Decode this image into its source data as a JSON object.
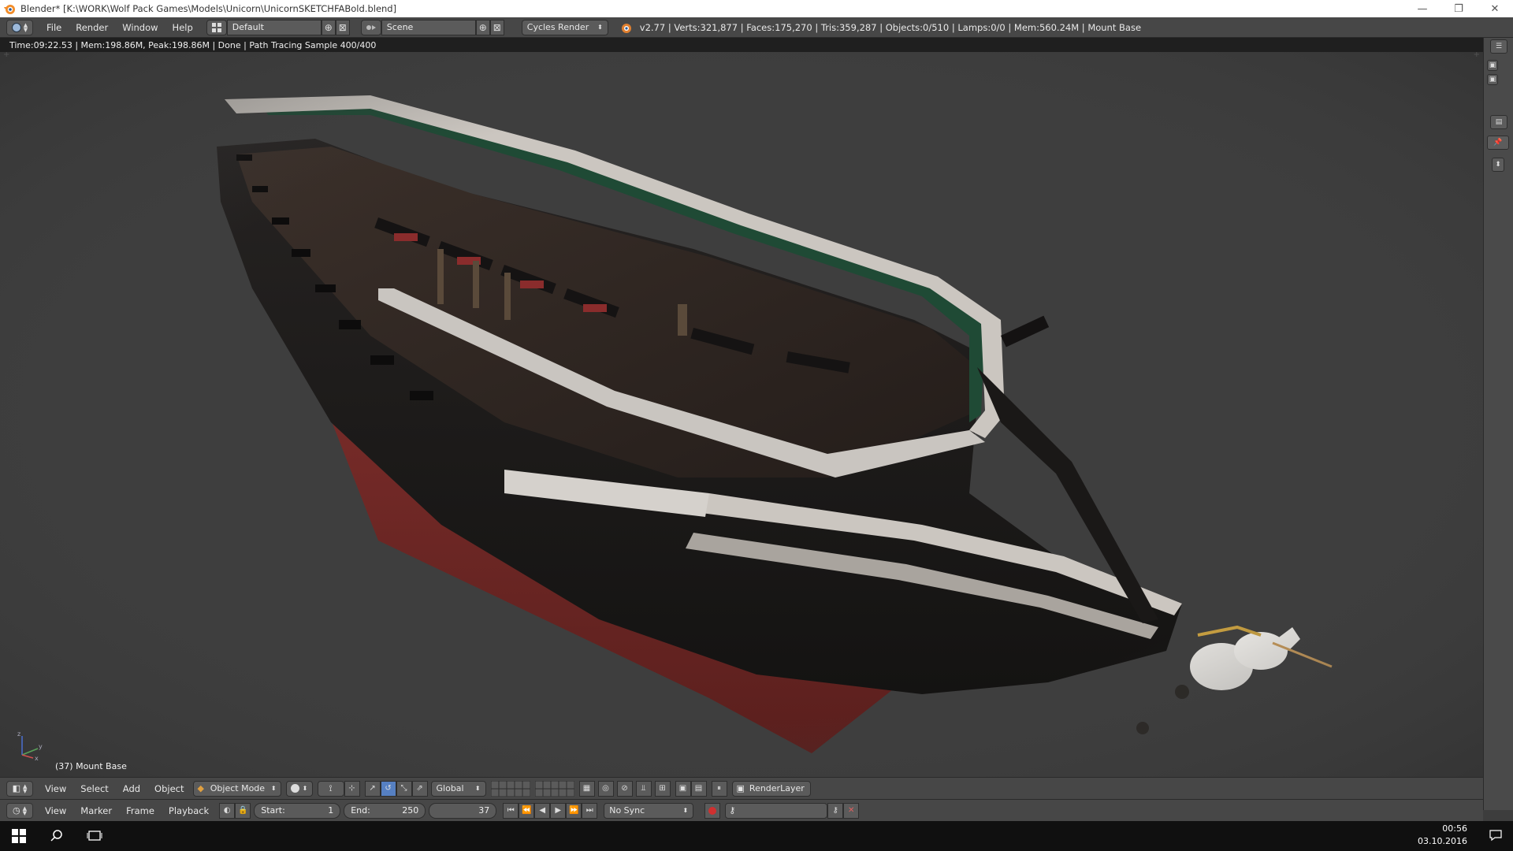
{
  "window": {
    "title": "Blender* [K:\\WORK\\Wolf Pack Games\\Models\\Unicorn\\UnicornSKETCHFABold.blend]",
    "minimize": "—",
    "restore": "❐",
    "close": "✕"
  },
  "info_header": {
    "menus": [
      "File",
      "Render",
      "Window",
      "Help"
    ],
    "screen_layout": "Default",
    "scene": "Scene",
    "render_engine": "Cycles Render",
    "stats": "v2.77 | Verts:321,877 | Faces:175,270 | Tris:359,287 | Objects:0/510 | Lamps:0/0 | Mem:560.24M | Mount Base"
  },
  "render_status": "Time:09:22.53 | Mem:198.86M, Peak:198.86M | Done | Path Tracing Sample 400/400",
  "viewport": {
    "object_label": "(37) Mount Base",
    "axis_labels": {
      "x": "x",
      "y": "y",
      "z": "z"
    }
  },
  "view3d_header": {
    "menus": [
      "View",
      "Select",
      "Add",
      "Object"
    ],
    "mode": "Object Mode",
    "orientation": "Global",
    "render_layer": "RenderLayer"
  },
  "timeline_header": {
    "menus": [
      "View",
      "Marker",
      "Frame",
      "Playback"
    ],
    "start_label": "Start:",
    "start_value": "1",
    "end_label": "End:",
    "end_value": "250",
    "current_frame": "37",
    "sync": "No Sync"
  },
  "taskbar": {
    "time": "00:56",
    "date": "03.10.2016"
  },
  "colors": {
    "viewport_bg": "#3e3e3e",
    "header_bg": "#474747",
    "active_blue": "#5680c2",
    "hull_dark": "#1c1a19",
    "hull_red": "#7a2a28",
    "rail_white": "#c9c5c0"
  }
}
